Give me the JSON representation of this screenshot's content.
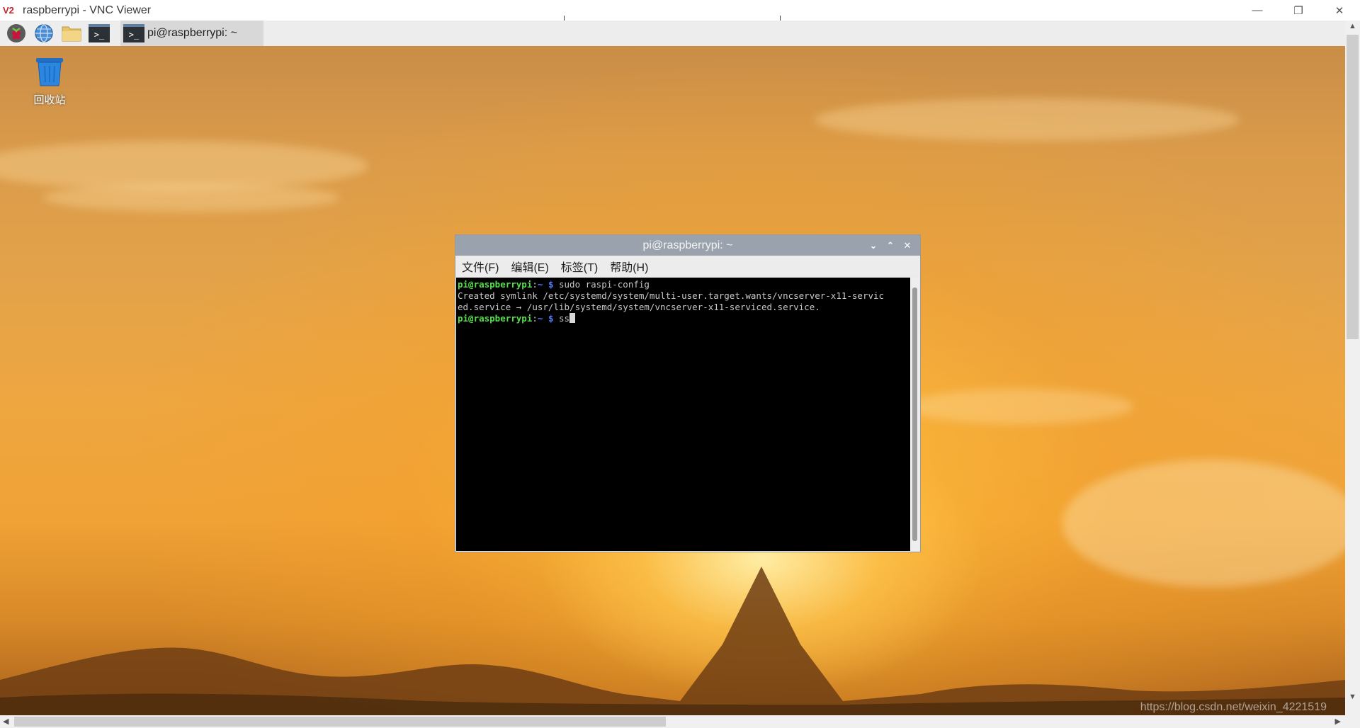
{
  "viewer": {
    "logo_text": "V2",
    "title": "raspberrypi - VNC Viewer",
    "controls": {
      "minimize": "—",
      "restore": "❐",
      "close": "✕"
    }
  },
  "panel": {
    "icons": [
      "raspberry-menu-icon",
      "web-browser-icon",
      "file-manager-icon",
      "terminal-launcher-icon"
    ],
    "launcher_terminal_glyph": ">_",
    "task_glyph": ">_",
    "task_label": "pi@raspberrypi: ~"
  },
  "desktop": {
    "trash_label": "回收站"
  },
  "terminal": {
    "title": "pi@raspberrypi: ~",
    "controls": {
      "minimize": "⌄",
      "maximize": "⌃",
      "close": "✕"
    },
    "menu": [
      "文件(F)",
      "编辑(E)",
      "标签(T)",
      "帮助(H)"
    ],
    "lines": {
      "l1_user": "pi@raspberrypi",
      "l1_sep": ":",
      "l1_path": "~ $",
      "l1_cmd": " sudo raspi-config",
      "l2": "Created symlink /etc/systemd/system/multi-user.target.wants/vncserver-x11-servic",
      "l3": "ed.service → /usr/lib/systemd/system/vncserver-x11-serviced.service.",
      "l4_user": "pi@raspberrypi",
      "l4_sep": ":",
      "l4_path": "~ $",
      "l4_cmd": " ss"
    }
  },
  "watermark": "https://blog.csdn.net/weixin_4221519",
  "colors": {
    "prompt_user": "#55e04b",
    "prompt_path": "#5a7cff",
    "terminal_bg": "#000000",
    "term_titlebar": "#9aa3ad"
  }
}
